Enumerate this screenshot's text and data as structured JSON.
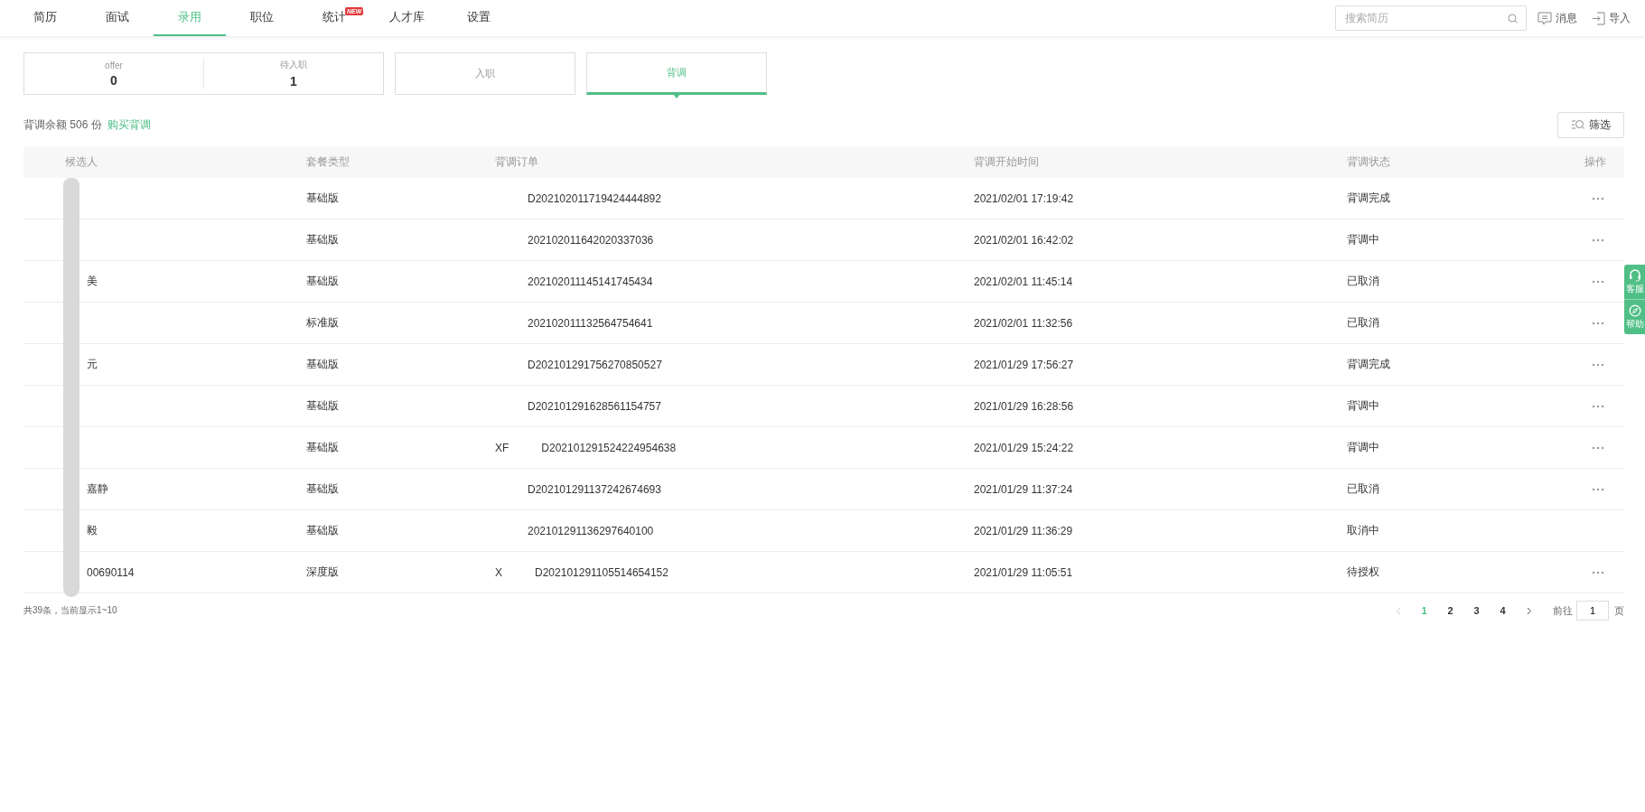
{
  "nav": {
    "tabs": [
      {
        "label": "简历",
        "selected": false
      },
      {
        "label": "面试",
        "selected": false
      },
      {
        "label": "录用",
        "selected": true
      },
      {
        "label": "职位",
        "selected": false
      },
      {
        "label": "统计",
        "selected": false,
        "badge": "NEW"
      },
      {
        "label": "人才库",
        "selected": false
      },
      {
        "label": "设置",
        "selected": false
      }
    ],
    "search": {
      "placeholder": "搜索简历"
    },
    "actions": [
      {
        "kind": "message",
        "label": "消息"
      },
      {
        "kind": "import",
        "label": "导入"
      }
    ]
  },
  "cards": [
    {
      "kind": "stats",
      "selected": false,
      "stats": [
        {
          "label": "offer",
          "value": "0"
        },
        {
          "label": "待入职",
          "value": "1"
        }
      ]
    },
    {
      "kind": "label",
      "selected": false,
      "label": "入职"
    },
    {
      "kind": "label",
      "selected": true,
      "label": "背调"
    }
  ],
  "balance": {
    "text": "背调余额 506 份",
    "link": "购买背调"
  },
  "filter_button": "筛选",
  "table": {
    "columns": [
      "候选人",
      "套餐类型",
      "背调订单",
      "背调开始时间",
      "背调状态",
      "操作"
    ],
    "rows": [
      {
        "package": "基础版",
        "order": "D202102011719424444892",
        "start": "2021/02/01 17:19:42",
        "status": "背调完成",
        "has_actions": true
      },
      {
        "package": "基础版",
        "order": "202102011642020337036",
        "start": "2021/02/01 16:42:02",
        "status": "背调中",
        "has_actions": true
      },
      {
        "name": "美",
        "package": "基础版",
        "order": "202102011145141745434",
        "start": "2021/02/01 11:45:14",
        "status": "已取消",
        "has_actions": true
      },
      {
        "package": "标准版",
        "order": "202102011132564754641",
        "start": "2021/02/01 11:32:56",
        "status": "已取消",
        "has_actions": true
      },
      {
        "name": "元",
        "package": "基础版",
        "order": "D202101291756270850527",
        "start": "2021/01/29 17:56:27",
        "status": "背调完成",
        "has_actions": true
      },
      {
        "package": "基础版",
        "order": "D202101291628561154757",
        "start": "2021/01/29 16:28:56",
        "status": "背调中",
        "has_actions": true
      },
      {
        "package": "基础版",
        "order_prefix": "XF",
        "order": "D202101291524224954638",
        "start": "2021/01/29 15:24:22",
        "status": "背调中",
        "has_actions": true
      },
      {
        "name": "嘉静",
        "package": "基础版",
        "order": "D202101291137242674693",
        "start": "2021/01/29 11:37:24",
        "status": "已取消",
        "has_actions": true
      },
      {
        "name": "毅",
        "package": "基础版",
        "order": "202101291136297640100",
        "start": "2021/01/29 11:36:29",
        "status": "取消中",
        "has_actions": false
      },
      {
        "name": "00690114",
        "package": "深度版",
        "order_prefix": "X",
        "order": "D202101291105514654152",
        "start": "2021/01/29 11:05:51",
        "status": "待授权",
        "has_actions": true
      }
    ]
  },
  "footer": {
    "summary": "共39条，当前显示1~10",
    "pages": [
      {
        "label": "1",
        "selected": true
      },
      {
        "label": "2",
        "selected": false
      },
      {
        "label": "3",
        "selected": false
      },
      {
        "label": "4",
        "selected": false
      }
    ],
    "goto_label": "前往",
    "goto_value": "1",
    "page_unit": "页"
  },
  "side_tabs": [
    {
      "kind": "service",
      "label": "客服"
    },
    {
      "kind": "help",
      "label": "帮助"
    }
  ]
}
